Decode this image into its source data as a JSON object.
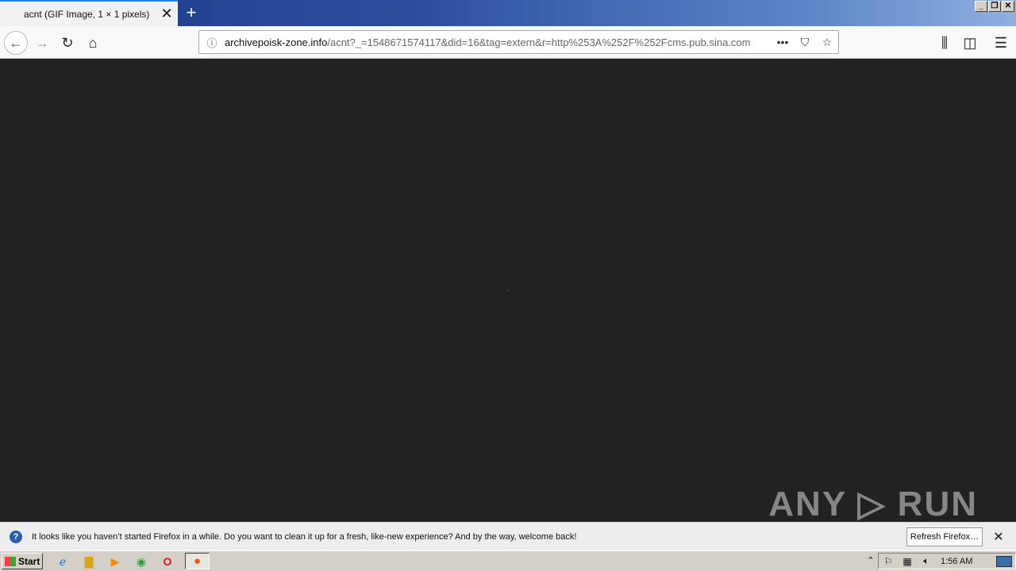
{
  "browser": {
    "tab_title": "acnt (GIF Image, 1 × 1 pixels)",
    "tab_close": "✕",
    "new_tab": "+",
    "window_buttons": [
      "_",
      "❐",
      "✕"
    ],
    "url_host": "archivepoisk-zone.info",
    "url_path": "/acnt?_=1548671574117&did=16&tag=extern&r=http%253A%252F%252Fcms.pub.sina.com"
  },
  "icons": {
    "back": "back-arrow-icon",
    "forward": "forward-arrow-icon",
    "reload": "reload-icon",
    "home": "home-icon",
    "info": "info-icon",
    "more": "more-icon",
    "pocket": "pocket-icon",
    "bookmark": "star-icon",
    "library": "library-icon",
    "sidebar": "sidebar-icon",
    "menu": "hamburger-menu-icon"
  },
  "notification": {
    "text": "It looks like you haven’t started Firefox in a while. Do you want to clean it up for a fresh, like-new experience? And by the way, welcome back!",
    "button": "Refresh Firefox…",
    "close": "✕"
  },
  "watermark": "ANY ▷ RUN",
  "taskbar": {
    "start": "Start",
    "clock": "1:56 AM"
  },
  "colors": {
    "content_bg": "#222222",
    "accent": "#0a84ff"
  }
}
